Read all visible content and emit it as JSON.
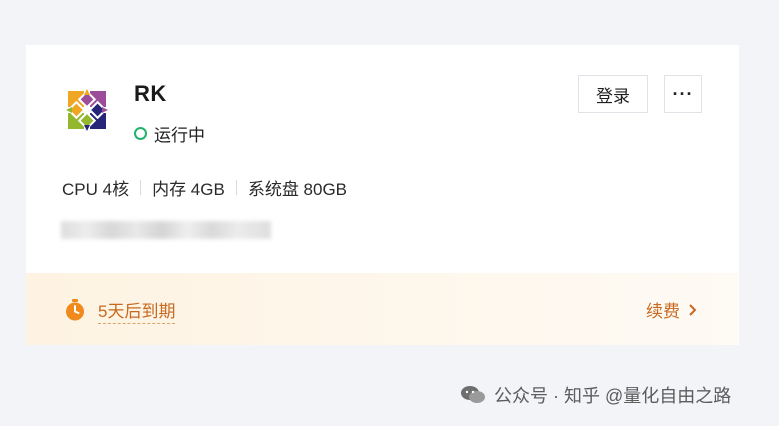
{
  "server": {
    "name": "RK",
    "status": "运行中",
    "os_icon": "centos-logo-icon",
    "actions": {
      "login_label": "登录",
      "more_label": "···"
    },
    "specs": [
      "CPU 4核",
      "内存 4GB",
      "系统盘 80GB"
    ]
  },
  "footer": {
    "expire_text": "5天后到期",
    "renew_label": "续费",
    "icons": {
      "timer": "timer-icon",
      "chevron": "chevron-right-icon"
    }
  },
  "watermark": {
    "text": "公众号 · 知乎 @量化自由之路",
    "icon": "wechat-icon"
  },
  "colors": {
    "status_green": "#1fb36b",
    "accent_orange": "#c8691f",
    "footer_bg": "#fef3e2"
  }
}
